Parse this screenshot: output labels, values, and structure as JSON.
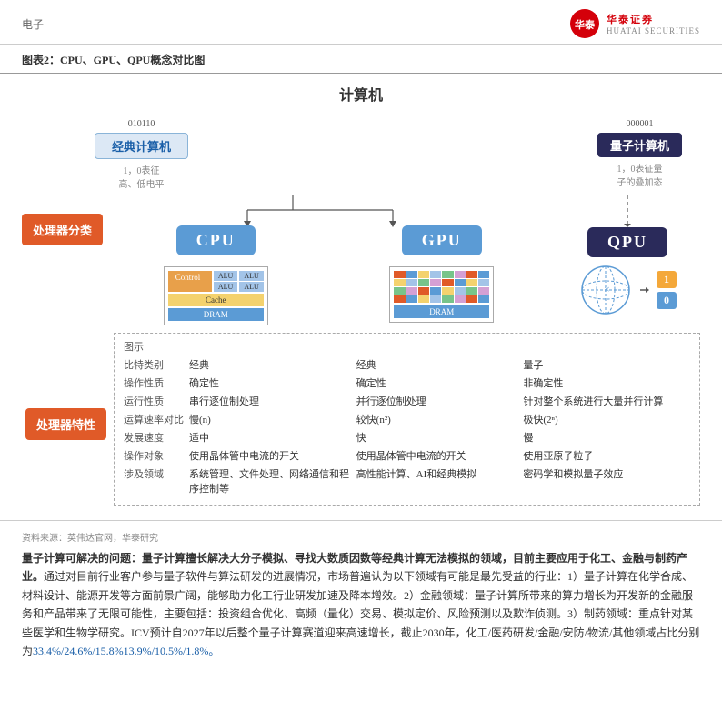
{
  "header": {
    "category": "电子",
    "logo_text": "华泰证券",
    "logo_sub": "HUATAI SECURITIES",
    "logo_box": "华泰"
  },
  "section": {
    "title": "图表2：CPU、GPU、QPU概念对比图"
  },
  "diagram": {
    "title": "计算机",
    "classical_label": "经典计算机",
    "classical_bits_1": "010110",
    "classical_bits_2": "1，0表征",
    "classical_bits_3": "高、低电平",
    "quantum_label": "量子计算机",
    "quantum_bits_1": "000001",
    "quantum_bits_2": "1，0表征量",
    "quantum_bits_3": "子的叠加态",
    "processor_category_label": "处理器分类",
    "cpu_label": "CPU",
    "gpu_label": "GPU",
    "qpu_label": "QPU",
    "diagram_label": "图示",
    "cpu_control": "Control",
    "cpu_alu": "ALU",
    "cpu_cache": "Cache",
    "cpu_dram": "DRAM",
    "gpu_dram": "DRAM"
  },
  "properties": {
    "section_label": "处理器特性",
    "rows": [
      {
        "label": "比特类别",
        "cpu_val": "经典",
        "gpu_val": "经典",
        "qpu_val": "量子"
      },
      {
        "label": "操作性质",
        "cpu_val": "确定性",
        "gpu_val": "确定性",
        "qpu_val": "非确定性"
      },
      {
        "label": "运行性质",
        "cpu_val": "串行逐位制处理",
        "gpu_val": "并行逐位制处理",
        "qpu_val": "针对整个系统进行大量并行计算"
      },
      {
        "label": "运算速率对比",
        "cpu_val": "慢(n)",
        "gpu_val": "较快(n²)",
        "qpu_val": "极快(2ⁿ)"
      },
      {
        "label": "发展速度",
        "cpu_val": "适中",
        "gpu_val": "快",
        "qpu_val": "慢"
      },
      {
        "label": "操作对象",
        "cpu_val": "使用晶体管中电流的开关",
        "gpu_val": "使用晶体管中电流的开关",
        "qpu_val": "使用亚原子粒子"
      },
      {
        "label": "涉及领域",
        "cpu_val": "系统管理、文件处理、网络通信和程序控制等",
        "gpu_val": "高性能计算、AI和经典模拟",
        "qpu_val": "密码学和模拟量子效应"
      }
    ]
  },
  "source": "资料来源：英伟达官网，华泰研究",
  "body_text": {
    "paragraph": "量子计算可解决的问题：量子计算擅长解决大分子模拟、寻找大数质因数等经典计算无法模拟的领域，目前主要应用于化工、金融与制药产业。通过对目前行业客户参与量子软件与算法研发的进展情况，市场普遍认为以下领域有可能是最先受益的行业：1）量子计算在化学合成、材料设计、能源开发等方面前景广阔，能够助力化工行业研发加速及降本增效。2）金融领域：量子计算所带来的算力增长为开发新的金融服务和产品带来了无限可能性，主要包括：投资组合优化、高频（量化）交易、模拟定价、风险预测以及欺诈侦测。3）制药领域：重点针对某些医学和生物学研究。ICV预计自2027年以后整个量子计算赛道迎来高速增长，截止2030年，化工/医药研发/金融/安防/物流/其他领域占比分别为33.4%/24.6%/15.8%13.9%/10.5%/1.8%。",
    "bold_intro": "量子计算可解决的问题：量子计算擅长解决大分子模拟、寻找大数质因数等经典计算无法模拟的领域，目前主要应用于化工、金融与制药产业。",
    "rest": "通过对目前行业客户参与量子软件与算法研发的进展情况，市场普遍认为以下领域有可能是最先受益的行业：1）量子计算在化学合成、材料设计、能源开发等方面前景广阔，能够助力化工行业研发加速及降本增效。2）金融领域：量子计算所带来的算力增长为开发新的金融服务和产品带来了无限可能性，主要包括：投资组合优化、高频（量化）交易、模拟定价、风险预测以及欺诈侦测。3）制药领域：重点针对某些医学和生物学研究。ICV预计自2027年以后整个量子计算赛道迎来高速增长，截止2030年，化工/医药研发/金融/安防/物流/其他领域占比分别为",
    "blue_end": "33.4%/24.6%/15.8%13.9%/10.5%/1.8%。"
  }
}
